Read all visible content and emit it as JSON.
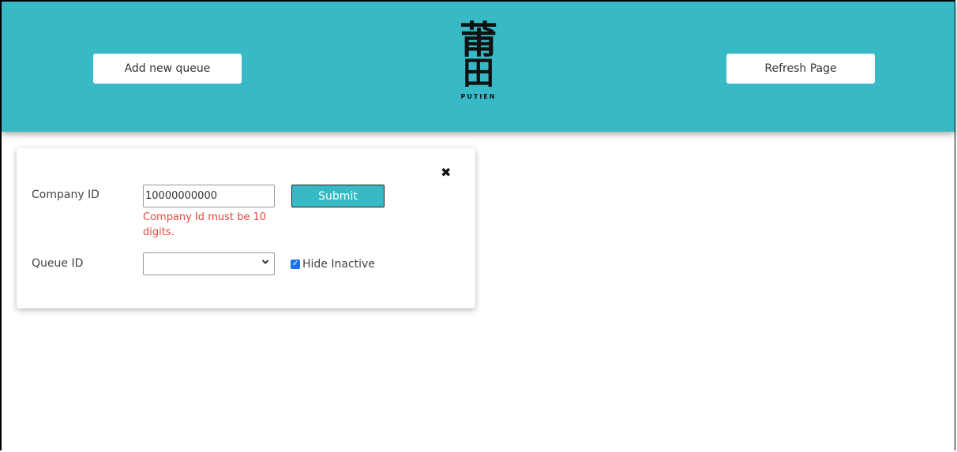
{
  "header": {
    "add_label": "Add new queue",
    "refresh_label": "Refresh Page",
    "logo": {
      "char1": "莆",
      "char2": "田",
      "name": "PUTIEN"
    },
    "color": "#37bac6"
  },
  "form": {
    "close_icon": "✖",
    "company_label": "Company ID",
    "company_value": "10000000000",
    "company_error": "Company Id must be 10 digits.",
    "submit_label": "Submit",
    "queue_label": "Queue ID",
    "queue_selected": "",
    "hide_inactive_label": "Hide Inactive",
    "hide_inactive_checked": true,
    "error_color": "#e8453c"
  }
}
